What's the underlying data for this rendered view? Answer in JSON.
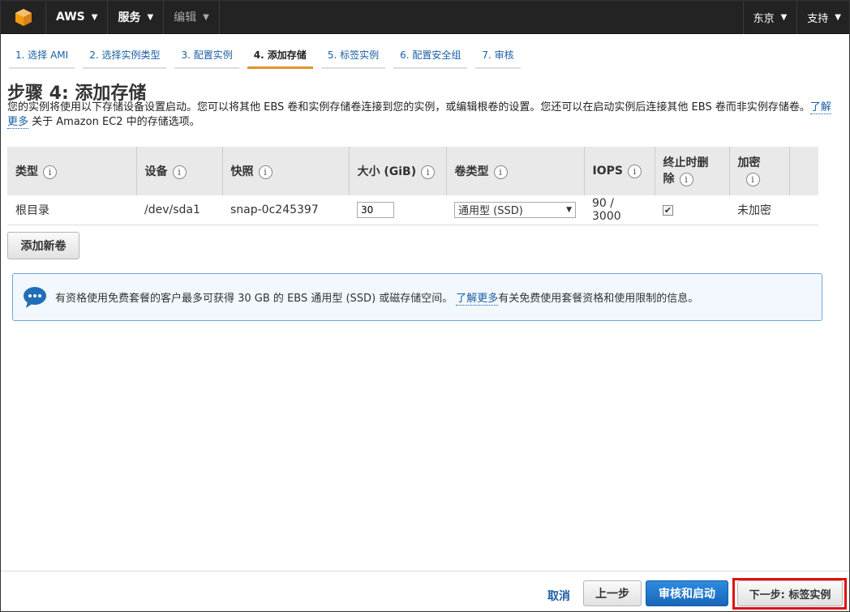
{
  "nav": {
    "aws": "AWS",
    "services": "服务",
    "edit": "编辑",
    "region": "东京",
    "support": "支持"
  },
  "tabs": [
    {
      "label": "1. 选择 AMI"
    },
    {
      "label": "2. 选择实例类型"
    },
    {
      "label": "3. 配置实例"
    },
    {
      "label": "4. 添加存储"
    },
    {
      "label": "5. 标签实例"
    },
    {
      "label": "6. 配置安全组"
    },
    {
      "label": "7. 审核"
    }
  ],
  "page": {
    "title": "步骤 4: 添加存储",
    "desc_1": "您的实例将使用以下存储设备设置启动。您可以将其他 EBS 卷和实例存储卷连接到您的实例，或编辑根卷的设置。您还可以在启动实例后连接其他 EBS 卷而非实例存储卷。",
    "desc_link": "了解更多",
    "desc_2": " 关于 Amazon EC2 中的存储选项。"
  },
  "table": {
    "headers": {
      "type": "类型",
      "device": "设备",
      "snapshot": "快照",
      "size": "大小 (GiB)",
      "volume_type": "卷类型",
      "iops": "IOPS",
      "delete_on_termination_1": "终止时删",
      "delete_on_termination_2": "除",
      "encrypted_1": "加密"
    },
    "row": {
      "type": "根目录",
      "device": "/dev/sda1",
      "snapshot": "snap-0c245397",
      "size": "30",
      "volume_type": "通用型 (SSD)",
      "iops": "90 / 3000",
      "delete_on_termination": true,
      "encrypted": "未加密"
    }
  },
  "buttons": {
    "add_volume": "添加新卷",
    "cancel": "取消",
    "previous": "上一步",
    "review_launch": "审核和启动",
    "next": "下一步: 标签实例"
  },
  "info": {
    "text_1": "有资格使用免费套餐的客户最多可获得 30 GB 的 EBS 通用型 (SSD) 或磁存储空间。",
    "link": "了解更多",
    "text_2": " 有关免费使用套餐资格和使用限制的信息。"
  },
  "colors": {
    "accent": "#e5912c",
    "link": "#1a5fa5",
    "highlight": "#e01010"
  }
}
